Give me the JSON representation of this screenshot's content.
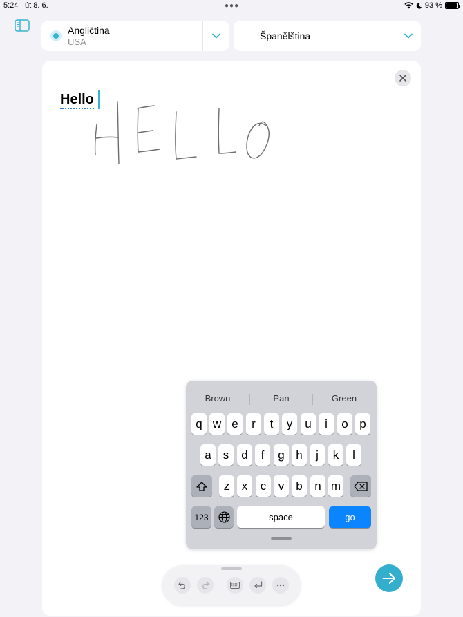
{
  "status_bar": {
    "time": "5:24",
    "date": "út 8. 6.",
    "battery_text": "93 %",
    "battery_level": 0.93
  },
  "languages": {
    "source": {
      "name": "Angličtina",
      "region": "USA"
    },
    "target": {
      "name": "Španělština"
    }
  },
  "canvas": {
    "recognized_text": "Hello",
    "handwriting_icon": "handwritten-hello"
  },
  "keyboard": {
    "suggestions": [
      "Brown",
      "Pan",
      "Green"
    ],
    "row1": [
      "q",
      "w",
      "e",
      "r",
      "t",
      "y",
      "u",
      "i",
      "o",
      "p"
    ],
    "row2": [
      "a",
      "s",
      "d",
      "f",
      "g",
      "h",
      "j",
      "k",
      "l"
    ],
    "row3": [
      "z",
      "x",
      "c",
      "v",
      "b",
      "n",
      "m"
    ],
    "numbers_label": "123",
    "space_label": "space",
    "go_label": "go"
  },
  "toolbar": {
    "icons": [
      "undo-icon",
      "redo-icon",
      "keyboard-icon",
      "return-icon",
      "more-icon"
    ]
  },
  "colors": {
    "accent": "#34aecd",
    "go_key": "#0a84ff",
    "background": "#f2f2f7"
  }
}
